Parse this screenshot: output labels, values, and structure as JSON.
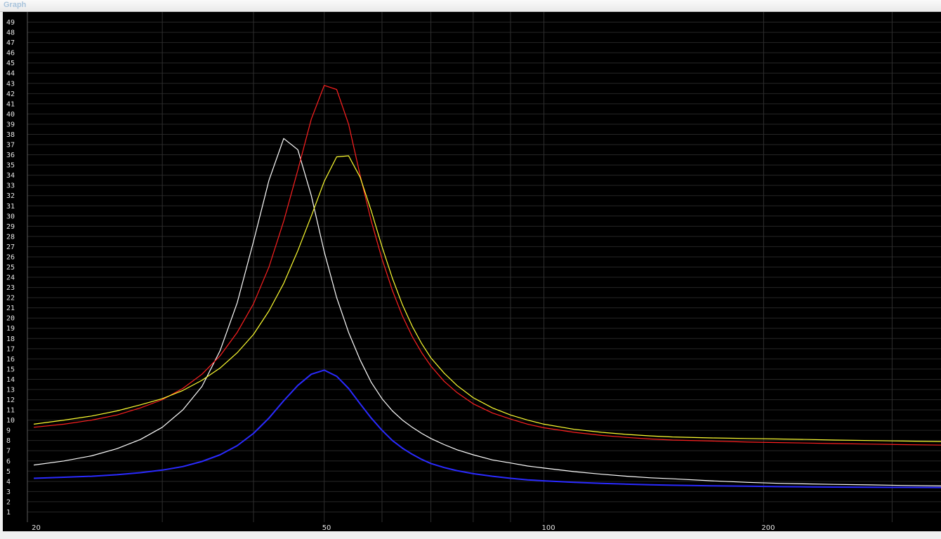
{
  "window": {
    "title": "Graph"
  },
  "chart_data": {
    "type": "line",
    "xscale": "log",
    "xlim": [
      19.6,
      350
    ],
    "ylim": [
      0,
      50
    ],
    "grid": true,
    "background": "#000000",
    "yticks": [
      1,
      2,
      3,
      4,
      5,
      6,
      7,
      8,
      9,
      10,
      11,
      12,
      13,
      14,
      15,
      16,
      17,
      18,
      19,
      20,
      21,
      22,
      23,
      24,
      25,
      26,
      27,
      28,
      29,
      30,
      31,
      32,
      33,
      34,
      35,
      36,
      37,
      38,
      39,
      40,
      41,
      42,
      43,
      44,
      45,
      46,
      47,
      48,
      49
    ],
    "xticks_major": [
      20,
      50,
      100,
      200
    ],
    "xgrid": [
      30,
      40,
      50,
      60,
      70,
      80,
      90,
      100,
      200,
      300
    ],
    "x": [
      20,
      22,
      24,
      26,
      28,
      30,
      32,
      34,
      36,
      38,
      40,
      42,
      44,
      46,
      48,
      50,
      52,
      54,
      56,
      58,
      60,
      62,
      64,
      66,
      68,
      70,
      73,
      76,
      80,
      85,
      90,
      95,
      100,
      110,
      120,
      130,
      140,
      150,
      170,
      190,
      210,
      230,
      250,
      280,
      310,
      350
    ],
    "series": [
      {
        "color": "#ffffff",
        "values": [
          5.6,
          6.0,
          6.5,
          7.2,
          8.1,
          9.3,
          11.0,
          13.3,
          16.8,
          21.5,
          27.5,
          33.5,
          37.6,
          36.5,
          32.0,
          26.5,
          22.0,
          18.6,
          15.9,
          13.7,
          12.1,
          10.9,
          10.0,
          9.3,
          8.7,
          8.2,
          7.6,
          7.1,
          6.6,
          6.1,
          5.8,
          5.5,
          5.3,
          4.95,
          4.7,
          4.5,
          4.35,
          4.25,
          4.05,
          3.9,
          3.8,
          3.75,
          3.7,
          3.65,
          3.6,
          3.55
        ]
      },
      {
        "color": "#ff2020",
        "values": [
          9.3,
          9.6,
          10.0,
          10.5,
          11.2,
          12.0,
          13.1,
          14.5,
          16.3,
          18.6,
          21.4,
          25.0,
          29.5,
          34.5,
          39.5,
          42.8,
          42.4,
          39.0,
          34.0,
          29.5,
          25.8,
          22.7,
          20.2,
          18.2,
          16.6,
          15.3,
          13.8,
          12.7,
          11.6,
          10.7,
          10.1,
          9.6,
          9.25,
          8.8,
          8.5,
          8.3,
          8.15,
          8.05,
          7.95,
          7.85,
          7.8,
          7.75,
          7.7,
          7.65,
          7.6,
          7.55
        ]
      },
      {
        "color": "#ffff30",
        "values": [
          9.6,
          10.0,
          10.4,
          10.9,
          11.5,
          12.1,
          12.9,
          13.9,
          15.1,
          16.6,
          18.4,
          20.7,
          23.4,
          26.6,
          30.0,
          33.4,
          35.8,
          35.9,
          33.8,
          30.5,
          27.0,
          23.9,
          21.3,
          19.2,
          17.5,
          16.1,
          14.6,
          13.4,
          12.2,
          11.2,
          10.5,
          10.0,
          9.6,
          9.1,
          8.8,
          8.6,
          8.45,
          8.35,
          8.25,
          8.2,
          8.15,
          8.1,
          8.05,
          8.0,
          7.95,
          7.9
        ]
      },
      {
        "color": "#2a2aff",
        "values": [
          4.3,
          4.4,
          4.5,
          4.65,
          4.85,
          5.1,
          5.45,
          5.95,
          6.6,
          7.5,
          8.7,
          10.2,
          11.9,
          13.4,
          14.5,
          14.9,
          14.3,
          13.1,
          11.6,
          10.2,
          9.0,
          8.0,
          7.25,
          6.65,
          6.15,
          5.75,
          5.35,
          5.05,
          4.75,
          4.5,
          4.3,
          4.15,
          4.05,
          3.9,
          3.8,
          3.72,
          3.66,
          3.62,
          3.56,
          3.52,
          3.48,
          3.46,
          3.44,
          3.42,
          3.41,
          3.4
        ]
      }
    ]
  }
}
